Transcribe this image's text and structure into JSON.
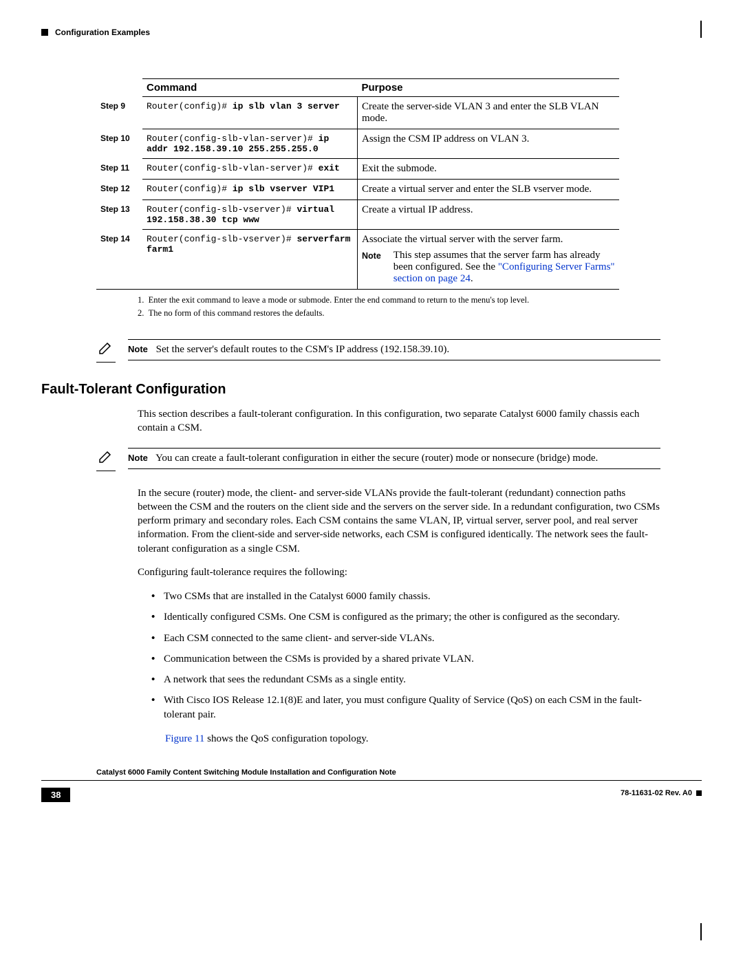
{
  "header": {
    "section": "Configuration Examples"
  },
  "table": {
    "head": {
      "command": "Command",
      "purpose": "Purpose"
    },
    "rows": [
      {
        "step": "Step 9",
        "prompt": "Router(config)# ",
        "cmd": "ip slb vlan 3 server",
        "purpose": "Create the server-side VLAN 3 and enter the SLB VLAN mode."
      },
      {
        "step": "Step 10",
        "prompt": "Router(config-slb-vlan-server)# ",
        "cmd": "ip addr 192.158.39.10 255.255.255.0",
        "purpose": "Assign the CSM IP address on VLAN 3."
      },
      {
        "step": "Step 11",
        "prompt": "Router(config-slb-vlan-server)# ",
        "cmd": "exit",
        "purpose": "Exit the submode."
      },
      {
        "step": "Step 12",
        "prompt": "Router(config)# ",
        "cmd": "ip slb vserver VIP1",
        "purpose": "Create a virtual server and enter the SLB vserver mode."
      },
      {
        "step": "Step 13",
        "prompt": "Router(config-slb-vserver)# ",
        "cmd": "virtual 192.158.38.30 tcp www",
        "purpose": "Create a virtual IP address."
      },
      {
        "step": "Step 14",
        "prompt": "Router(config-slb-vserver)# ",
        "cmd": "serverfarm farm1",
        "purpose": "Associate the virtual server with the server farm.",
        "note_label": "Note",
        "note_text": "This step assumes that the server farm has already been configured. See the ",
        "note_link": "\"Configuring Server Farms\" section on page 24",
        "note_tail": "."
      }
    ]
  },
  "footnotes": {
    "f1": "Enter the exit command to leave a mode or submode. Enter the end command to return to the menu's top level.",
    "f2": "The no form of this command restores the defaults."
  },
  "note1": {
    "label": "Note",
    "text": "Set the server's default routes to the CSM's IP address (192.158.39.10)."
  },
  "section_title": "Fault-Tolerant Configuration",
  "para1": "This section describes a fault-tolerant configuration. In this configuration, two separate Catalyst 6000 family chassis each contain a CSM.",
  "note2": {
    "label": "Note",
    "text": "You can create a fault-tolerant configuration in either the secure (router) mode or nonsecure (bridge) mode."
  },
  "para2": "In the secure (router) mode, the client- and server-side VLANs provide the fault-tolerant (redundant) connection paths between the CSM and the routers on the client side and the servers on the server side. In a redundant configuration, two CSMs perform primary and secondary roles. Each CSM contains the same VLAN, IP, virtual server, server pool, and real server information. From the client-side and server-side networks, each CSM is configured identically. The network sees the fault-tolerant configuration as a single CSM.",
  "para3": "Configuring fault-tolerance requires the following:",
  "bullets": [
    "Two CSMs that are installed in the Catalyst 6000 family chassis.",
    "Identically configured CSMs. One CSM is configured as the primary; the other is configured as the secondary.",
    "Each CSM connected to the same client- and server-side VLANs.",
    "Communication between the CSMs is provided by a shared private VLAN.",
    "A network that sees the redundant CSMs as a single entity.",
    "With Cisco IOS Release 12.1(8)E and later, you must configure Quality of Service (QoS) on each CSM in the fault-tolerant pair."
  ],
  "fig_ref": "Figure 11",
  "fig_text": " shows the QoS configuration topology.",
  "footer": {
    "title": "Catalyst 6000 Family Content Switching Module Installation and Configuration Note",
    "page": "38",
    "docid": "78-11631-02 Rev. A0"
  }
}
